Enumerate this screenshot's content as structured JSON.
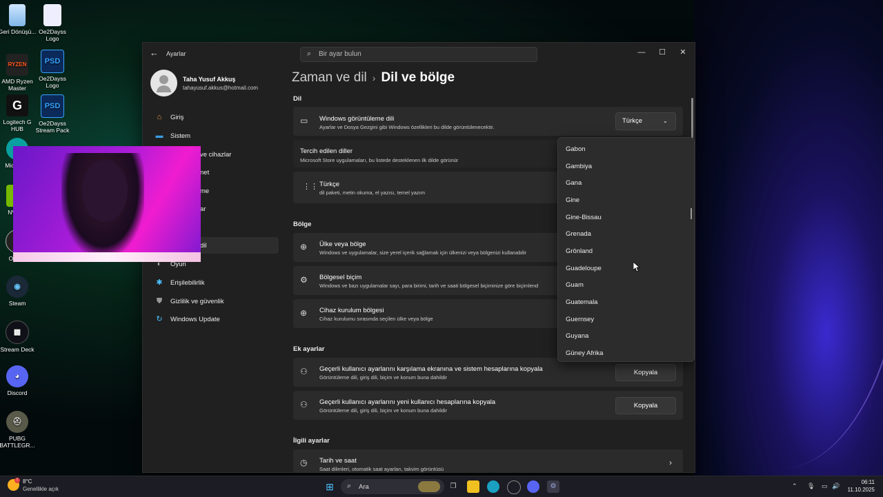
{
  "desktop": {
    "icons_left": [
      {
        "label": "Geri Dönüşü...",
        "icon": "recycle-bin-icon"
      },
      {
        "label": "AMD Ryzen Master",
        "icon": "amd-ryzen-icon"
      },
      {
        "label": "Logitech G HUB",
        "icon": "logitech-icon"
      },
      {
        "label": "Mic... E...",
        "icon": "edge-icon"
      },
      {
        "label": "NVID...",
        "icon": "nvidia-icon"
      },
      {
        "label": "OBS...",
        "icon": "obs-icon"
      },
      {
        "label": "Steam",
        "icon": "steam-icon"
      },
      {
        "label": "Stream Deck",
        "icon": "stream-deck-icon"
      },
      {
        "label": "Discord",
        "icon": "discord-icon"
      },
      {
        "label": "PUBG BATTLEGR...",
        "icon": "pubg-icon"
      }
    ],
    "icons_right": [
      {
        "label": "Oe2Dayss Logo",
        "icon": "file-icon"
      },
      {
        "label": "Oe2Dayss Logo",
        "icon": "psd-icon",
        "badge": "PSD"
      },
      {
        "label": "Oe2Dayss Stream Pack",
        "icon": "psd-icon",
        "badge": "PSD"
      }
    ]
  },
  "window": {
    "app_title": "Ayarlar",
    "search_placeholder": "Bir ayar bulun",
    "user": {
      "name": "Taha Yusuf Akkuş",
      "email": "tahayusuf.akkus@hotmail.com"
    },
    "nav": [
      {
        "label": "Giriş",
        "icon": "home-icon"
      },
      {
        "label": "Sistem",
        "icon": "system-icon"
      },
      {
        "label": "ve cihazlar",
        "icon": "bluetooth-icon"
      },
      {
        "label": "net",
        "icon": "network-icon"
      },
      {
        "label": "me",
        "icon": "personalization-icon"
      },
      {
        "label": "ar",
        "icon": "apps-icon"
      },
      {
        "label": "",
        "icon": "accounts-icon"
      },
      {
        "label": "dil",
        "icon": "time-language-icon"
      },
      {
        "label": "Oyun",
        "icon": "gaming-icon"
      },
      {
        "label": "Erişilebilirlik",
        "icon": "accessibility-icon"
      },
      {
        "label": "Gizlilik ve güvenlik",
        "icon": "shield-icon"
      },
      {
        "label": "Windows Update",
        "icon": "update-icon"
      }
    ],
    "breadcrumb": {
      "parent": "Zaman ve dil",
      "separator": "›",
      "current": "Dil ve bölge"
    },
    "section_dil": "Dil",
    "display_language": {
      "title": "Windows görüntüleme dili",
      "subtitle": "Ayarlar ve Dosya Gezgini gibi Windows özellikleri bu dilde görüntülenecektir.",
      "value": "Türkçe"
    },
    "preferred": {
      "title": "Tercih edilen diller",
      "subtitle": "Microsoft Store uygulamaları, bu listede desteklenen ilk dilde görünür"
    },
    "turkish_pack": {
      "title": "Türkçe",
      "subtitle": "dil paketi, metin okuma, el yazısı, temel yazım"
    },
    "section_bolge": "Bölge",
    "country": {
      "title": "Ülke veya bölge",
      "subtitle": "Windows ve uygulamalar, size yerel içerik sağlamak için ülkenizi veya bölgenizi kullanabilir"
    },
    "regional_format": {
      "title": "Bölgesel biçim",
      "subtitle": "Windows ve bazı uygulamalar sayı, para birimi, tarih ve saati bölgesel biçiminize göre biçimlend"
    },
    "device_region": {
      "title": "Cihaz kurulum bölgesi",
      "subtitle": "Cihaz kurulumu sırasında seçilen ülke veya bölge"
    },
    "section_ek": "Ek ayarlar",
    "copy_welcome": {
      "title": "Geçerli kullanıcı ayarlarını karşılama ekranına ve sistem hesaplarına kopyala",
      "subtitle": "Görüntüleme dili, giriş dili, biçim ve konum buna dahildir",
      "button": "Kopyala"
    },
    "copy_new": {
      "title": "Geçerli kullanıcı ayarlarını yeni kullanıcı hesaplarına kopyala",
      "subtitle": "Görüntüleme dili, giriş dili, biçim ve konum buna dahildir",
      "button": "Kopyala"
    },
    "section_ilgili": "İlgili ayarlar",
    "date_time": {
      "title": "Tarih ve saat",
      "subtitle": "Saat dilimleri, otomatik saat ayarları, takvim görüntüsü"
    },
    "country_dropdown": [
      "Gabon",
      "Gambiya",
      "Gana",
      "Gine",
      "Gine-Bissau",
      "Grenada",
      "Grönland",
      "Guadeloupe",
      "Guam",
      "Guatemala",
      "Guernsey",
      "Guyana",
      "Güney Afrika"
    ]
  },
  "taskbar": {
    "weather_temp": "8°C",
    "weather_desc": "Genellikle açık",
    "search_label": "Ara",
    "time": "06:11",
    "date": "11.10.2025"
  }
}
